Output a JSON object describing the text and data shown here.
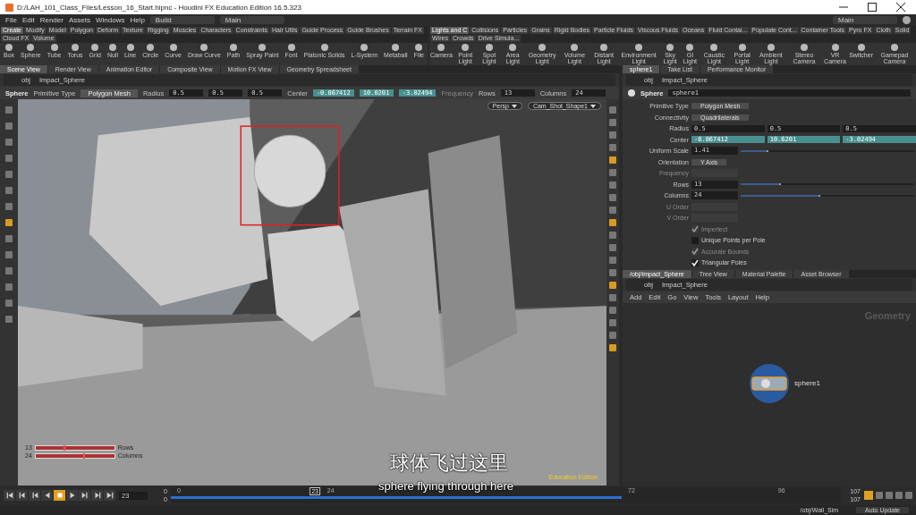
{
  "window": {
    "title": "D:/LAH_101_Class_Files/Lesson_16_Start.hipnc - Houdini FX Education Edition 16.5.323"
  },
  "menu": [
    "File",
    "Edit",
    "Render",
    "Assets",
    "Windows",
    "Help"
  ],
  "desktop": "Build",
  "main_left": "Main",
  "main_right": "Main",
  "shelf_left": {
    "tabs": [
      {
        "label": "Create",
        "selected": true
      },
      {
        "label": "Modify",
        "selected": false
      },
      {
        "label": "Model",
        "selected": false
      },
      {
        "label": "Polygon",
        "selected": false
      },
      {
        "label": "Deform",
        "selected": false
      },
      {
        "label": "Texture",
        "selected": false
      },
      {
        "label": "Rigging",
        "selected": false
      },
      {
        "label": "Muscles",
        "selected": false
      },
      {
        "label": "Characters",
        "selected": false
      },
      {
        "label": "Constraints",
        "selected": false
      },
      {
        "label": "Hair Utils",
        "selected": false
      },
      {
        "label": "Guide Process",
        "selected": false
      },
      {
        "label": "Guide Brushes",
        "selected": false
      },
      {
        "label": "Terrain FX",
        "selected": false
      },
      {
        "label": "Cloud FX",
        "selected": false
      },
      {
        "label": "Volume",
        "selected": false
      }
    ],
    "tools": [
      "Box",
      "Sphere",
      "Tube",
      "Torus",
      "Grid",
      "Null",
      "Line",
      "Circle",
      "Curve",
      "Draw Curve",
      "Path",
      "Spray Paint",
      "Font",
      "Platonic Solids",
      "L-System",
      "Metaball",
      "File"
    ]
  },
  "shelf_right": {
    "tabs": [
      {
        "label": "Lights and C",
        "selected": true
      },
      {
        "label": "Collisions",
        "selected": false
      },
      {
        "label": "Particles",
        "selected": false
      },
      {
        "label": "Grains",
        "selected": false
      },
      {
        "label": "Rigid Bodies",
        "selected": false
      },
      {
        "label": "Particle Fluids",
        "selected": false
      },
      {
        "label": "Viscous Fluids",
        "selected": false
      },
      {
        "label": "Oceans",
        "selected": false
      },
      {
        "label": "Fluid Contai...",
        "selected": false
      },
      {
        "label": "Populate Cont...",
        "selected": false
      },
      {
        "label": "Container Tools",
        "selected": false
      },
      {
        "label": "Pyro FX",
        "selected": false
      },
      {
        "label": "Cloth",
        "selected": false
      },
      {
        "label": "Solid",
        "selected": false
      },
      {
        "label": "Wires",
        "selected": false
      },
      {
        "label": "Crowds",
        "selected": false
      },
      {
        "label": "Drive Simula...",
        "selected": false
      }
    ],
    "tools": [
      "Camera",
      "Point Light",
      "Spot Light",
      "Area Light",
      "Geometry Light",
      "Volume Light",
      "Distant Light",
      "Environment Light",
      "Sky Light",
      "GI Light",
      "Caustic Light",
      "Portal Light",
      "Ambient Light",
      "Stereo Camera",
      "VR Camera",
      "Switcher",
      "Gamepad Camera"
    ]
  },
  "scene_view": {
    "tabs": [
      {
        "label": "Scene View",
        "selected": true
      },
      {
        "label": "Render View",
        "selected": false
      },
      {
        "label": "Animation Editor",
        "selected": false
      },
      {
        "label": "Composite View",
        "selected": false
      },
      {
        "label": "Motion FX View",
        "selected": false
      },
      {
        "label": "Geometry Spreadsheet",
        "selected": false
      }
    ],
    "path": [
      "obj",
      "Impact_Sphere"
    ],
    "operator": {
      "name": "Sphere",
      "fields": [
        {
          "kind": "label",
          "text": "Primitive Type",
          "disabled": false
        },
        {
          "kind": "menu",
          "text": "Polygon Mesh"
        },
        {
          "kind": "label",
          "text": "Radius",
          "disabled": false
        },
        {
          "kind": "value",
          "text": "0.5",
          "highlight": false
        },
        {
          "kind": "value",
          "text": "0.5",
          "highlight": false
        },
        {
          "kind": "value",
          "text": "0.5",
          "highlight": false
        },
        {
          "kind": "label",
          "text": "Center",
          "disabled": false
        },
        {
          "kind": "value",
          "text": "-0.867412",
          "highlight": true
        },
        {
          "kind": "value",
          "text": "10.0201",
          "highlight": true
        },
        {
          "kind": "value",
          "text": "-3.02494",
          "highlight": true
        },
        {
          "kind": "label",
          "text": "Frequency",
          "disabled": true
        },
        {
          "kind": "label",
          "text": "Rows",
          "disabled": false
        },
        {
          "kind": "value",
          "text": "13",
          "highlight": false
        },
        {
          "kind": "label",
          "text": "Columns",
          "disabled": false
        },
        {
          "kind": "value",
          "text": "24",
          "highlight": false
        }
      ]
    },
    "camera_menus": [
      "Persp",
      "Cam_Shot_Shape1"
    ],
    "handles": [
      {
        "value": "13",
        "label": "Rows",
        "level": 0.35
      },
      {
        "value": "24",
        "label": "Columns",
        "level": 0.6
      }
    ],
    "badge": "Education Edition"
  },
  "parameters": {
    "tabs": [
      {
        "label": "sphere1",
        "selected": true
      },
      {
        "label": "Take List",
        "selected": false
      },
      {
        "label": "Performance Monitor",
        "selected": false
      }
    ],
    "path": [
      "obj",
      "Impact_Sphere"
    ],
    "type": "Sphere",
    "node_name": "sphere1",
    "rows": [
      {
        "kind": "menu",
        "label": "Primitive Type",
        "value": "Polygon Mesh",
        "disabled": false
      },
      {
        "kind": "menu",
        "label": "Connectivity",
        "value": "Quadrilaterals",
        "disabled": false
      },
      {
        "kind": "vector",
        "label": "Radius",
        "values": [
          "0.5",
          "0.5",
          "0.5"
        ],
        "highlight": false,
        "disabled": false
      },
      {
        "kind": "vector",
        "label": "Center",
        "values": [
          "-0.867412",
          "10.6201",
          "-3.02494"
        ],
        "highlight": true,
        "disabled": false
      },
      {
        "kind": "slider",
        "label": "Uniform Scale",
        "value": "1.41",
        "level": 0.15,
        "disabled": false
      },
      {
        "kind": "menu",
        "label": "Orientation",
        "value": "Y Axis",
        "disabled": false
      },
      {
        "kind": "slider",
        "label": "Frequency",
        "disabled": true
      },
      {
        "kind": "slider",
        "label": "Rows",
        "value": "13",
        "level": 0.22,
        "disabled": false
      },
      {
        "kind": "slider",
        "label": "Columns",
        "value": "24",
        "level": 0.45,
        "disabled": false
      },
      {
        "kind": "slider",
        "label": "U Order",
        "disabled": true
      },
      {
        "kind": "slider",
        "label": "V Order",
        "disabled": true
      },
      {
        "kind": "checkbox",
        "label": "Imperfect",
        "checked": true,
        "disabled": true
      },
      {
        "kind": "checkbox",
        "label": "Unique Points per Pole",
        "checked": false,
        "disabled": false
      },
      {
        "kind": "checkbox",
        "label": "Accurate Bounds",
        "checked": true,
        "disabled": true
      },
      {
        "kind": "checkbox",
        "label": "Triangular Poles",
        "checked": true,
        "disabled": false
      }
    ]
  },
  "network": {
    "tabs": [
      {
        "label": "/obj/Impact_Sphere",
        "selected": true
      },
      {
        "label": "Tree View",
        "selected": false
      },
      {
        "label": "Material Palette",
        "selected": false
      },
      {
        "label": "Asset Browser",
        "selected": false
      }
    ],
    "path": [
      "obj",
      "Impact_Sphere"
    ],
    "menu": [
      "Add",
      "Edit",
      "Go",
      "View",
      "Tools",
      "Layout",
      "Help"
    ],
    "context": "Geometry",
    "node": {
      "name": "sphere1"
    }
  },
  "timeline": {
    "frame": "23",
    "start": [
      "0",
      "0"
    ],
    "end": [
      "107",
      "107"
    ],
    "ticks": [
      {
        "label": "0",
        "level": 0
      },
      {
        "label": "24",
        "level": 0.224
      },
      {
        "label": "72",
        "level": 0.673
      },
      {
        "label": "96",
        "level": 0.897
      }
    ],
    "current": {
      "label": "23",
      "level": 0.215
    },
    "cached": {
      "level": 0.673
    },
    "controls": [
      {
        "kind": "first",
        "selected": false
      },
      {
        "kind": "prevkey",
        "selected": false
      },
      {
        "kind": "stepback",
        "selected": false
      },
      {
        "kind": "reverse",
        "selected": false
      },
      {
        "kind": "stop",
        "selected": true
      },
      {
        "kind": "play",
        "selected": false
      },
      {
        "kind": "stepfwd",
        "selected": false
      },
      {
        "kind": "nextkey",
        "selected": false
      },
      {
        "kind": "last",
        "selected": false
      }
    ]
  },
  "status_bar": {
    "path": "/obj/Wall_Sim",
    "update": "Auto Update"
  },
  "subtitles": {
    "chinese": "球体飞过这里",
    "english": "sphere flying through here"
  }
}
